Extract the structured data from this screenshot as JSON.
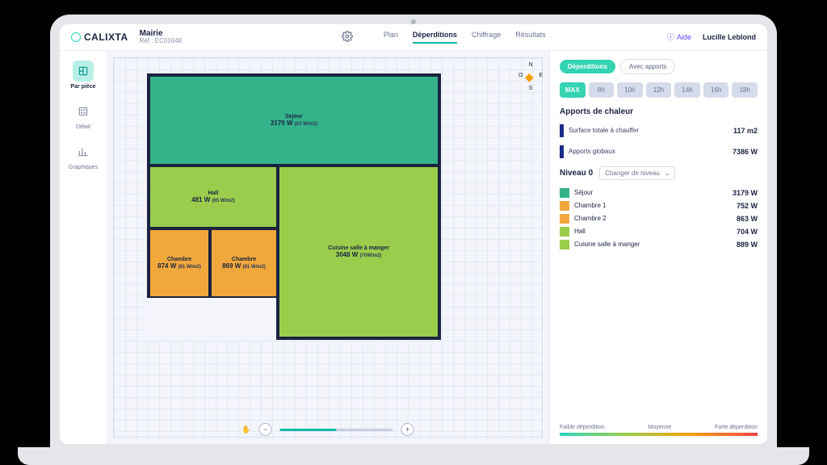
{
  "brand": "CALIXTA",
  "project": {
    "title": "Mairie",
    "ref": "Réf : EC01648"
  },
  "header": {
    "tabs": [
      "Plan",
      "Déperditions",
      "Chiffrage",
      "Résultats"
    ],
    "active_tab": "Déperditions",
    "help": "Aide",
    "user": "Lucille Leblond"
  },
  "sidebar": {
    "items": [
      {
        "label": "Par pièce"
      },
      {
        "label": "Détail"
      },
      {
        "label": "Graphiques"
      }
    ]
  },
  "compass": {
    "n": "N",
    "s": "S",
    "e": "E",
    "w": "O"
  },
  "rooms": {
    "sejour": {
      "name": "Sejour",
      "watts": "3179 W",
      "density": "(63 W/m2)"
    },
    "hall": {
      "name": "Hall",
      "watts": "481 W",
      "density": "(65 W/m2)"
    },
    "ch1": {
      "name": "Chambre",
      "watts": "874 W",
      "density": "(81 W/m2)"
    },
    "ch2": {
      "name": "Chambre",
      "watts": "869 W",
      "density": "(81 W/m2)"
    },
    "cuisine": {
      "name": "Cuisine salle à manger",
      "watts": "3048 W",
      "density": "(70W/m2)"
    }
  },
  "panel": {
    "toggle": {
      "a": "Déperditions",
      "b": "Avec apports"
    },
    "hours": [
      "MAX",
      "8h",
      "10h",
      "12h",
      "14h",
      "16h",
      "18h"
    ],
    "hours_active": "MAX",
    "section1_title": "Apports de chaleur",
    "metrics": [
      {
        "label": "Surface totale à chauffer",
        "value": "117 m2"
      },
      {
        "label": "Apports globaux",
        "value": "7386 W"
      }
    ],
    "level_label": "Niveau 0",
    "level_select": "Changer de niveau",
    "roomlist": [
      {
        "color": "#34b38a",
        "name": "Séjour",
        "watts": "3179 W"
      },
      {
        "color": "#f0a83c",
        "name": "Chambre 1",
        "watts": "752 W"
      },
      {
        "color": "#f0a83c",
        "name": "Chambre 2",
        "watts": "863 W"
      },
      {
        "color": "#9acd4c",
        "name": "Hall",
        "watts": "704 W"
      },
      {
        "color": "#9acd4c",
        "name": "Cuisine salle à manger",
        "watts": "889 W"
      }
    ],
    "legend": {
      "low": "Faible déperdition",
      "mid": "Moyenne",
      "high": "Forte déperdition"
    }
  }
}
